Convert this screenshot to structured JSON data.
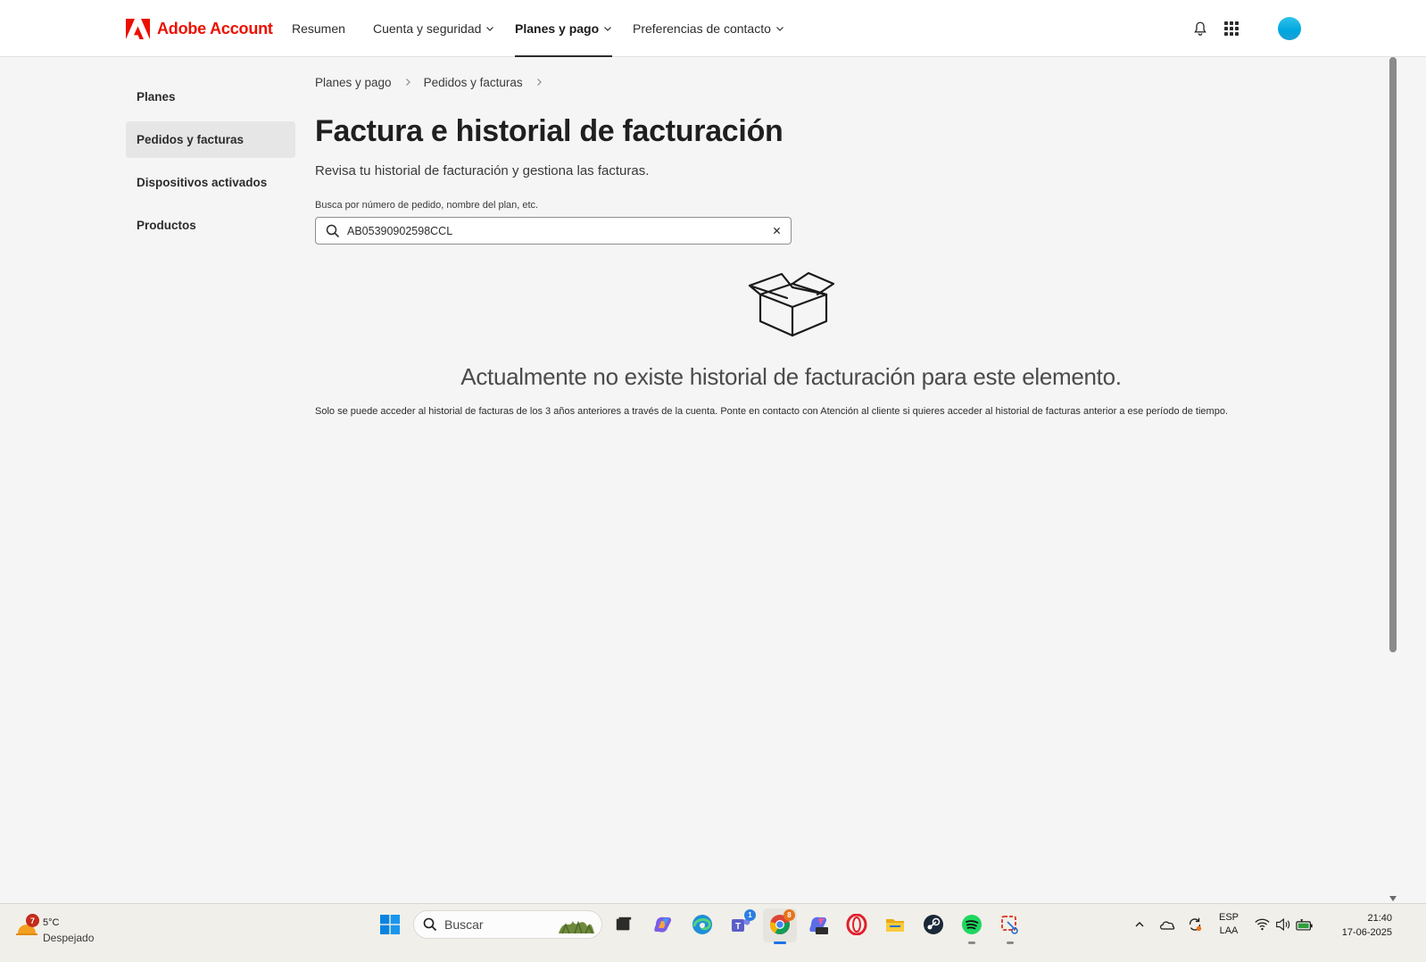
{
  "header": {
    "brand": "Adobe Account",
    "nav": [
      {
        "label": "Resumen",
        "dropdown": false,
        "active": false
      },
      {
        "label": "Cuenta y seguridad",
        "dropdown": true,
        "active": false
      },
      {
        "label": "Planes y pago",
        "dropdown": true,
        "active": true
      },
      {
        "label": "Preferencias de contacto",
        "dropdown": true,
        "active": false
      }
    ],
    "icons": [
      "bell-icon",
      "apps-grid-icon",
      "avatar"
    ]
  },
  "sidebar": {
    "items": [
      {
        "label": "Planes",
        "active": false
      },
      {
        "label": "Pedidos y facturas",
        "active": true
      },
      {
        "label": "Dispositivos activados",
        "active": false
      },
      {
        "label": "Productos",
        "active": false
      }
    ]
  },
  "breadcrumb": [
    "Planes y pago",
    "Pedidos y facturas"
  ],
  "main": {
    "title": "Factura e historial de facturación",
    "subtitle": "Revisa tu historial de facturación y gestiona las facturas.",
    "search_label": "Busca por número de pedido, nombre del plan, etc.",
    "search_value": "AB05390902598CCL",
    "empty_title": "Actualmente no existe historial de facturación para este elemento.",
    "empty_note": "Solo se puede acceder al historial de facturas de los 3 años anteriores a través de la cuenta. Ponte en contacto con Atención al cliente si quieres acceder al historial de facturas anterior a ese período de tiempo."
  },
  "taskbar": {
    "weather": {
      "badge": "7",
      "temp": "5°C",
      "desc": "Despejado"
    },
    "search_placeholder": "Buscar",
    "apps": [
      "start-icon",
      "task-view-icon",
      "copilot-icon",
      "edge-icon",
      "teams-icon",
      "chrome-icon",
      "m365-icon",
      "opera-icon",
      "file-explorer-icon",
      "steam-icon",
      "spotify-icon",
      "snipping-tool-icon"
    ],
    "badges": {
      "teams": "1",
      "chrome": "8"
    },
    "tray": {
      "lang_top": "ESP",
      "lang_bottom": "LAA"
    },
    "clock": {
      "time": "21:40",
      "date": "17-06-2025"
    }
  },
  "colors": {
    "brand": "#eb1000",
    "background": "#f5f5f5",
    "active_sidebar": "#e6e6e6"
  }
}
